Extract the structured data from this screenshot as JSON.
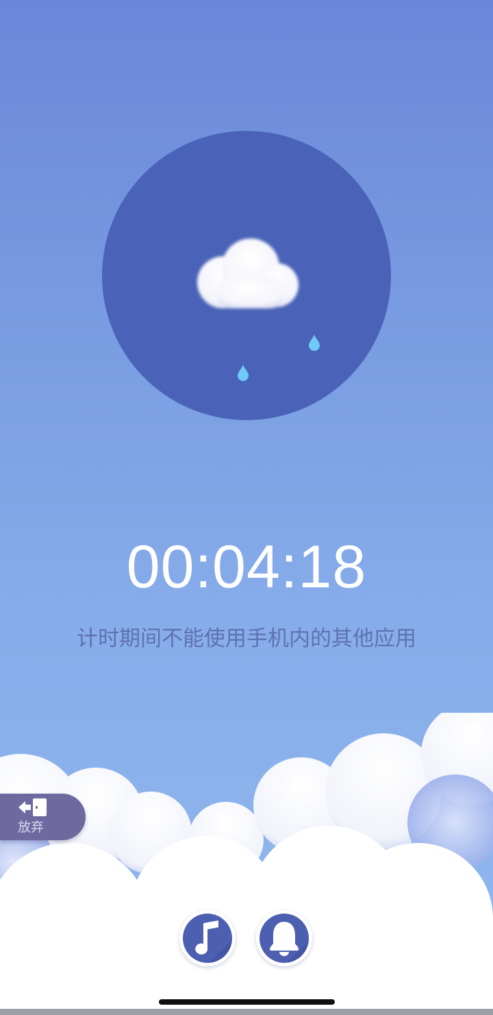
{
  "timer": {
    "elapsed": "00:04:18"
  },
  "tip": {
    "text": "计时期间不能使用手机内的其他应用"
  },
  "giveup": {
    "label": "放弃",
    "icon": "exit-door-icon"
  },
  "controls": {
    "music_icon": "music-note-icon",
    "alarm_icon": "bell-icon"
  },
  "weather": {
    "icon": "rain-cloud-icon"
  },
  "colors": {
    "sky_top": "#6b86d9",
    "sky_bottom": "#93b9ef",
    "circle": "#4a63b8",
    "raindrop": "#6fcaf5",
    "button": "#4d5fb0",
    "giveup_bg": "#6e6a9f",
    "tip_text": "#5f72b0"
  }
}
